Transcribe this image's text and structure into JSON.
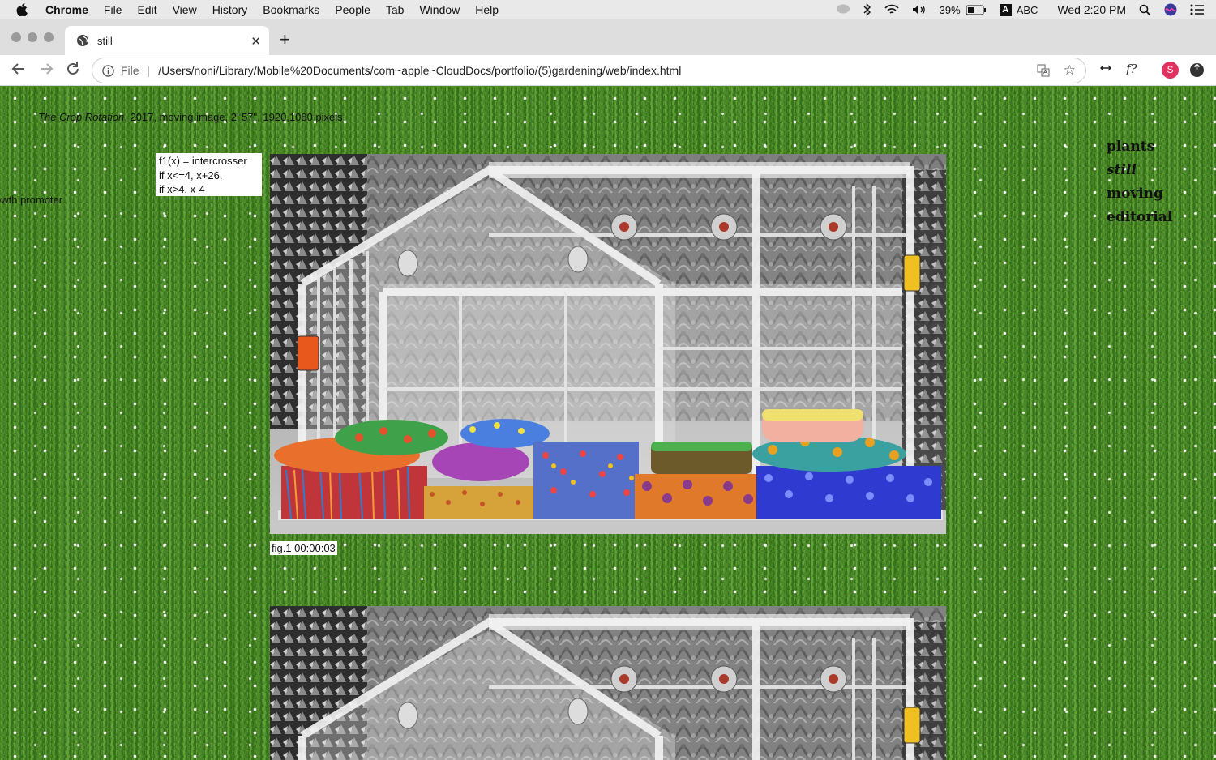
{
  "menubar": {
    "items": [
      "Chrome",
      "File",
      "Edit",
      "View",
      "History",
      "Bookmarks",
      "People",
      "Tab",
      "Window",
      "Help"
    ],
    "battery": "39%",
    "input_source": "ABC",
    "clock": "Wed 2:20 PM"
  },
  "tab": {
    "title": "still"
  },
  "toolbar": {
    "scheme": "File",
    "url": "/Users/noni/Library/Mobile%20Documents/com~apple~CloudDocs/portfolio/(5)gardening/web/index.html",
    "avatar_letter": "S",
    "extension_f": "f?"
  },
  "page": {
    "caption_title": "The Crop Rotation",
    "caption_rest": ", 2017, moving image, 2' 57\", 1920,1080 pixels",
    "function_lines": [
      "f1(x) = intercrosser",
      "if x<=4, x+26,",
      "if x>4, x-4"
    ],
    "growth_label": "owth promoter",
    "nav": [
      "plants",
      "still",
      "moving",
      "editorial"
    ],
    "figure_caption": "fig.1 00:00:03"
  },
  "colors": {
    "grass": "#4d8c2c",
    "accent_avatar": "#e0315f"
  }
}
